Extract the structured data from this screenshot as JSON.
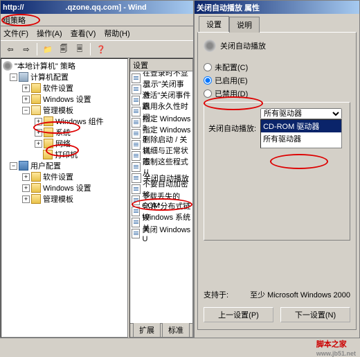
{
  "leftwin": {
    "title_prefix": "http://",
    "title_url": ".qzone.qq.com] - Wind",
    "app_title": "组策略",
    "menu": {
      "file": "文件(F)",
      "action": "操作(A)",
      "view": "查看(V)",
      "help": "帮助(H)"
    },
    "tree": {
      "root": "\"本地计算机\" 策略",
      "computer": "计算机配置",
      "software": "软件设置",
      "windows": "Windows 设置",
      "admin": "管理模板",
      "wincomp": "Windows 组件",
      "system": "系统",
      "network": "网络",
      "printer": "打印机",
      "user": "用户配置",
      "usoft": "软件设置",
      "uwin": "Windows 设置",
      "uadmin": "管理模板"
    },
    "list": {
      "header": "设置",
      "items": [
        "在登录时不显示",
        "显示\"关闭事件",
        "激活\"关闭事件跟",
        "启用永久性时间",
        "指定 Windows 3",
        "指定 Windows 3",
        "删除启动 / 关机",
        "详细与正常状态",
        "限制这些程式从",
        "关闭自动播放",
        "不要自动加密移",
        "下载丢失的 COM",
        "允许\"分布式链接",
        "Windows 系统关",
        "关闭 Windows U"
      ],
      "tabs": {
        "ext": "扩展",
        "std": "标准"
      }
    }
  },
  "rightwin": {
    "title": "关闭自动播放 属性",
    "tabs": {
      "setting": "设置",
      "explain": "说明"
    },
    "heading": "关闭自动播放",
    "radios": {
      "notcfg": "未配置(C)",
      "enabled": "已启用(E)",
      "disabled": "已禁用(D)"
    },
    "optlabel": "关闭自动播放:",
    "select_value": "所有驱动器",
    "list_options": [
      "CD-ROM 驱动器",
      "所有驱动器"
    ],
    "support_label": "支持于:",
    "support_value": "至少 Microsoft Windows 2000",
    "buttons": {
      "prev": "上一设置(P)",
      "next": "下一设置(N)"
    }
  },
  "watermark": {
    "text": "脚本之家",
    "url": "www.jb51.net"
  }
}
